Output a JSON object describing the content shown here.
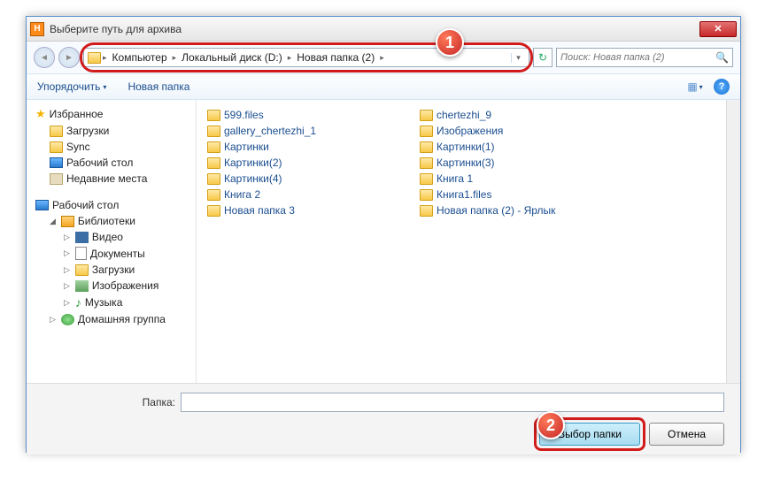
{
  "title": "Выберите путь для архива",
  "breadcrumb": {
    "c0": "Компьютер",
    "c1": "Локальный диск (D:)",
    "c2": "Новая папка (2)"
  },
  "search_placeholder": "Поиск: Новая папка (2)",
  "toolbar": {
    "organize": "Упорядочить",
    "newfolder": "Новая папка"
  },
  "sidebar": {
    "fav": "Избранное",
    "downloads": "Загрузки",
    "sync": "Sync",
    "desktop": "Рабочий стол",
    "recent": "Недавние места",
    "desk2": "Рабочий стол",
    "libs": "Библиотеки",
    "video": "Видео",
    "docs": "Документы",
    "dl2": "Загрузки",
    "imgs": "Изображения",
    "music": "Музыка",
    "home": "Домашняя группа"
  },
  "files": {
    "a0": "599.files",
    "a1": "gallery_chertezhi_1",
    "a2": "Картинки",
    "a3": "Картинки(2)",
    "a4": "Картинки(4)",
    "a5": "Книга 2",
    "a6": "Новая папка 3",
    "b0": "chertezhi_9",
    "b1": "Изображения",
    "b2": "Картинки(1)",
    "b3": "Картинки(3)",
    "b4": "Книга 1",
    "b5": "Книга1.files",
    "b6": "Новая папка (2) - Ярлык"
  },
  "bottom": {
    "label": "Папка:",
    "select": "Выбор папки",
    "cancel": "Отмена"
  },
  "markers": {
    "m1": "1",
    "m2": "2"
  }
}
